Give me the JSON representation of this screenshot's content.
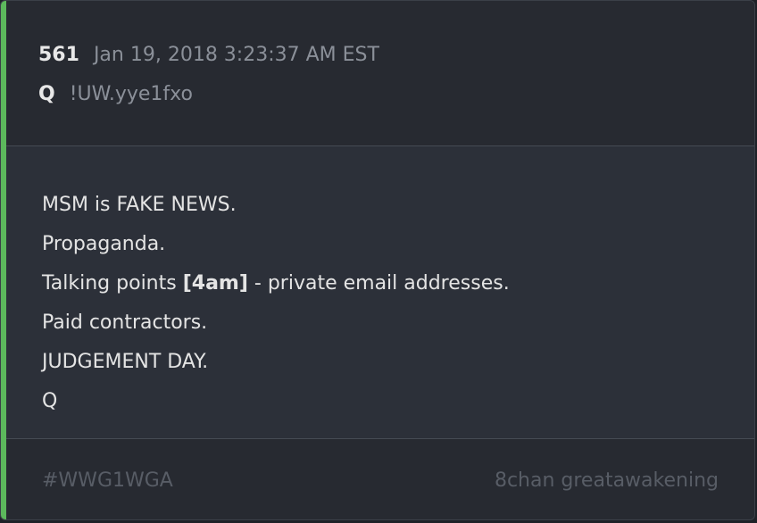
{
  "colors": {
    "accent": "#5cb85c",
    "background": "#2c3039",
    "header_background": "#272a31",
    "text": "#e4e4e4",
    "muted_text": "#8b9099",
    "faint_text": "#585d66"
  },
  "post": {
    "number": "561",
    "timestamp": "Jan 19, 2018 3:23:37 AM EST",
    "author": "Q",
    "tripcode": "!UW.yye1fxo",
    "lines": [
      {
        "text": "MSM is FAKE NEWS."
      },
      {
        "text": "Propaganda."
      },
      {
        "prefix": "Talking points ",
        "bold": "[4am]",
        "suffix": " - private email addresses."
      },
      {
        "text": "Paid contractors."
      },
      {
        "text": "JUDGEMENT DAY."
      },
      {
        "text": "Q"
      }
    ]
  },
  "footer": {
    "hashtag": "#WWG1WGA",
    "source": "8chan greatawakening"
  }
}
